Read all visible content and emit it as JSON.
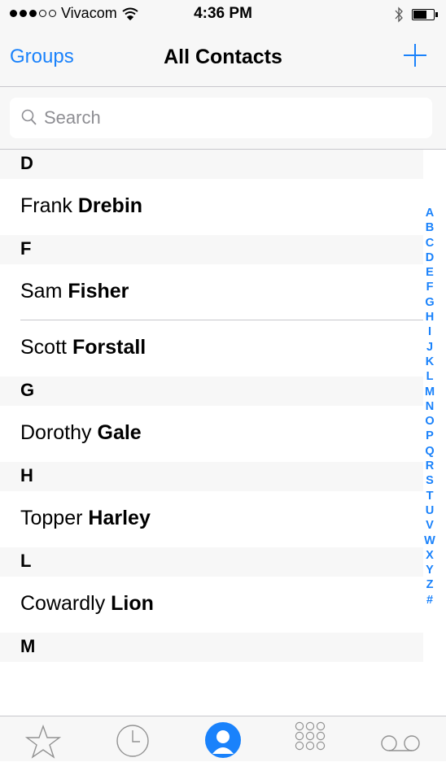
{
  "status": {
    "carrier": "Vivacom",
    "time": "4:36 PM"
  },
  "nav": {
    "left": "Groups",
    "title": "All Contacts"
  },
  "search": {
    "placeholder": "Search"
  },
  "sections": [
    {
      "letter": "D",
      "contacts": [
        {
          "first": "Frank",
          "last": "Drebin"
        }
      ]
    },
    {
      "letter": "F",
      "contacts": [
        {
          "first": "Sam",
          "last": "Fisher"
        },
        {
          "first": "Scott",
          "last": "Forstall"
        }
      ]
    },
    {
      "letter": "G",
      "contacts": [
        {
          "first": "Dorothy",
          "last": "Gale"
        }
      ]
    },
    {
      "letter": "H",
      "contacts": [
        {
          "first": "Topper",
          "last": "Harley"
        }
      ]
    },
    {
      "letter": "L",
      "contacts": [
        {
          "first": "Cowardly",
          "last": "Lion"
        }
      ]
    },
    {
      "letter": "M",
      "contacts": []
    }
  ],
  "index": [
    "A",
    "B",
    "C",
    "D",
    "E",
    "F",
    "G",
    "H",
    "I",
    "J",
    "K",
    "L",
    "M",
    "N",
    "O",
    "P",
    "Q",
    "R",
    "S",
    "T",
    "U",
    "V",
    "W",
    "X",
    "Y",
    "Z",
    "#"
  ],
  "colors": {
    "accent": "#1a82fb",
    "section_bg": "#f7f7f7",
    "separator": "#c8c7cc"
  },
  "tabs": [
    {
      "icon": "star-icon"
    },
    {
      "icon": "clock-icon"
    },
    {
      "icon": "contacts-icon",
      "selected": true
    },
    {
      "icon": "keypad-icon"
    },
    {
      "icon": "voicemail-icon"
    }
  ]
}
